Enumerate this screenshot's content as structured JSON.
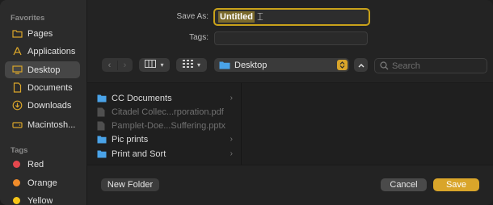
{
  "sidebar": {
    "favorites_heading": "Favorites",
    "favorites": [
      {
        "label": "Pages",
        "icon": "folder-icon"
      },
      {
        "label": "Applications",
        "icon": "applications-icon"
      },
      {
        "label": "Desktop",
        "icon": "desktop-icon",
        "selected": true
      },
      {
        "label": "Documents",
        "icon": "document-icon"
      },
      {
        "label": "Downloads",
        "icon": "downloads-icon"
      },
      {
        "label": "Macintosh...",
        "icon": "drive-icon"
      }
    ],
    "tags_heading": "Tags",
    "tags": [
      {
        "label": "Red",
        "color": "#e5484d"
      },
      {
        "label": "Orange",
        "color": "#f08c2a"
      },
      {
        "label": "Yellow",
        "color": "#f5c518"
      }
    ]
  },
  "form": {
    "save_as_label": "Save As:",
    "save_as_value": "Untitled",
    "tags_label": "Tags:"
  },
  "toolbar": {
    "location": "Desktop",
    "search_placeholder": "Search"
  },
  "files": [
    {
      "name": "CC Documents",
      "type": "folder",
      "enabled": true,
      "has_children": true
    },
    {
      "name": "Citadel Collec...rporation.pdf",
      "type": "file",
      "enabled": false,
      "has_children": false
    },
    {
      "name": "Pamplet-Doe...Suffering.pptx",
      "type": "file",
      "enabled": false,
      "has_children": false
    },
    {
      "name": "Pic prints",
      "type": "folder",
      "enabled": true,
      "has_children": true
    },
    {
      "name": "Print and Sort",
      "type": "folder",
      "enabled": true,
      "has_children": true
    }
  ],
  "buttons": {
    "new_folder": "New Folder",
    "cancel": "Cancel",
    "save": "Save"
  },
  "colors": {
    "accent": "#d9a52a",
    "folder": "#4aa3e8"
  }
}
